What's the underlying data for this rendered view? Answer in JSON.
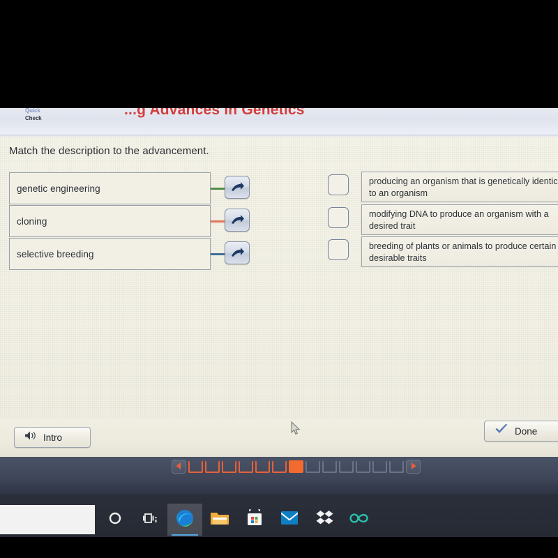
{
  "header": {
    "quick_check_line1": "Quick",
    "quick_check_line2": "Check",
    "title": "...g Advances in Genetics"
  },
  "main": {
    "prompt": "Match the description to the advancement.",
    "terms": [
      {
        "label": "genetic engineering",
        "connector_color": "#4f8f46",
        "arrow_icon": "arrow-right-icon"
      },
      {
        "label": "cloning",
        "connector_color": "#e2745b",
        "arrow_icon": "arrow-right-icon"
      },
      {
        "label": "selective breeding",
        "connector_color": "#3f6f9b",
        "arrow_icon": "arrow-right-icon"
      }
    ],
    "descriptions": [
      {
        "text": "producing an organism that is genetically identical to an organism",
        "checked": false
      },
      {
        "text": "modifying DNA to produce an organism with a desired trait",
        "checked": false
      },
      {
        "text": "breeding of plants or animals to produce certain desirable traits",
        "checked": false
      }
    ]
  },
  "toolbar": {
    "intro_label": "Intro",
    "intro_icon": "speaker-icon",
    "done_label": "Done",
    "done_icon": "checkmark-icon"
  },
  "pager": {
    "prev_icon": "triangle-left-icon",
    "next_icon": "triangle-right-icon",
    "cells": [
      "done",
      "done",
      "done",
      "done",
      "done",
      "done",
      "current",
      "todo",
      "todo",
      "todo",
      "todo",
      "todo",
      "todo"
    ],
    "current_index": 7,
    "total": 13,
    "done_color": "#e8603a",
    "current_color": "#f26a2e",
    "todo_color": "#69748c"
  },
  "taskbar": {
    "search_placeholder": "",
    "items": [
      {
        "icon": "cortana-circle-icon",
        "active": false
      },
      {
        "icon": "task-view-icon",
        "active": false
      },
      {
        "icon": "microsoft-edge-icon",
        "active": true
      },
      {
        "icon": "file-explorer-icon",
        "active": false
      },
      {
        "icon": "microsoft-store-icon",
        "active": false
      },
      {
        "icon": "mail-icon",
        "active": false
      },
      {
        "icon": "dropbox-icon",
        "active": false
      },
      {
        "icon": "office-infinity-icon",
        "active": false
      }
    ]
  }
}
